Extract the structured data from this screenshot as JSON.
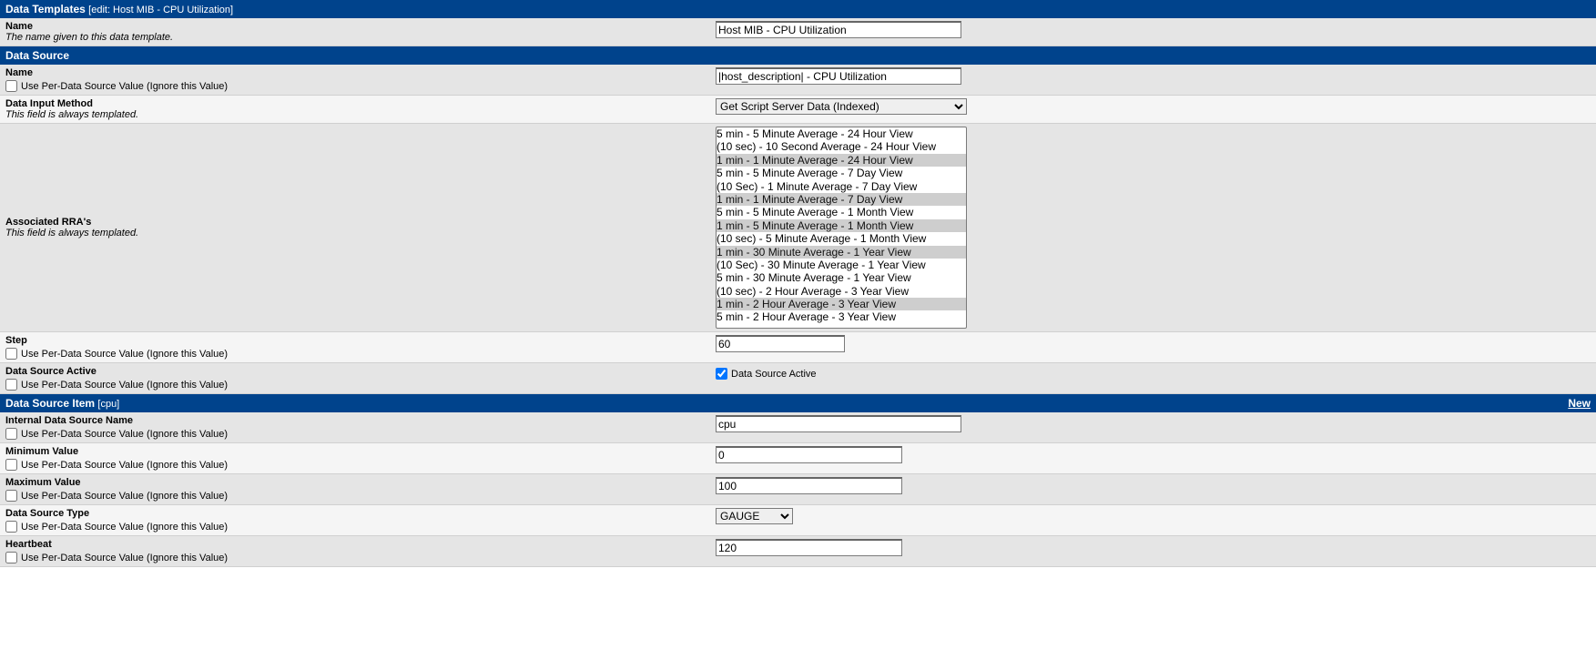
{
  "headers": {
    "data_templates": "Data Templates",
    "data_templates_sub": "[edit: Host MIB - CPU Utilization]",
    "data_source": "Data Source",
    "data_source_item": "Data Source Item",
    "data_source_item_sub": "[cpu]",
    "new_link": "New"
  },
  "labels": {
    "name": "Name",
    "name_desc": "The name given to this data template.",
    "per_ds": "Use Per-Data Source Value (Ignore this Value)",
    "data_input_method": "Data Input Method",
    "always_templated": "This field is always templated.",
    "assoc_rra": "Associated RRA's",
    "step": "Step",
    "ds_active": "Data Source Active",
    "ds_active_chk": "Data Source Active",
    "internal_ds_name": "Internal Data Source Name",
    "min_value": "Minimum Value",
    "max_value": "Maximum Value",
    "ds_type": "Data Source Type",
    "heartbeat": "Heartbeat"
  },
  "values": {
    "template_name": "Host MIB - CPU Utilization",
    "ds_name": "|host_description| - CPU Utilization",
    "data_input_method": "Get Script Server Data (Indexed)",
    "step": "60",
    "internal_ds_name": "cpu",
    "min_value": "0",
    "max_value": "100",
    "ds_type": "GAUGE",
    "heartbeat": "120"
  },
  "rra_options": [
    {
      "label": "5 min - 5 Minute Average - 24 Hour View",
      "selected": false
    },
    {
      "label": "(10 sec) - 10 Second Average - 24 Hour View",
      "selected": false
    },
    {
      "label": "1 min - 1 Minute Average - 24 Hour View",
      "selected": true
    },
    {
      "label": "5 min - 5 Minute Average - 7 Day View",
      "selected": false
    },
    {
      "label": "(10 Sec) - 1 Minute Average - 7 Day View",
      "selected": false
    },
    {
      "label": "1 min - 1 Minute Average - 7 Day View",
      "selected": true
    },
    {
      "label": "5 min - 5 Minute Average - 1 Month View",
      "selected": false
    },
    {
      "label": "1 min - 5 Minute Average - 1 Month View",
      "selected": true
    },
    {
      "label": "(10 sec) - 5 Minute Average - 1 Month View",
      "selected": false
    },
    {
      "label": "1 min - 30 Minute Average - 1 Year View",
      "selected": true
    },
    {
      "label": "(10 Sec) - 30 Minute Average - 1 Year View",
      "selected": false
    },
    {
      "label": "5 min - 30 Minute Average - 1 Year View",
      "selected": false
    },
    {
      "label": "(10 sec) - 2 Hour Average - 3 Year View",
      "selected": false
    },
    {
      "label": "1 min - 2 Hour Average - 3 Year View",
      "selected": true
    },
    {
      "label": "5 min - 2 Hour Average - 3 Year View",
      "selected": false
    }
  ]
}
